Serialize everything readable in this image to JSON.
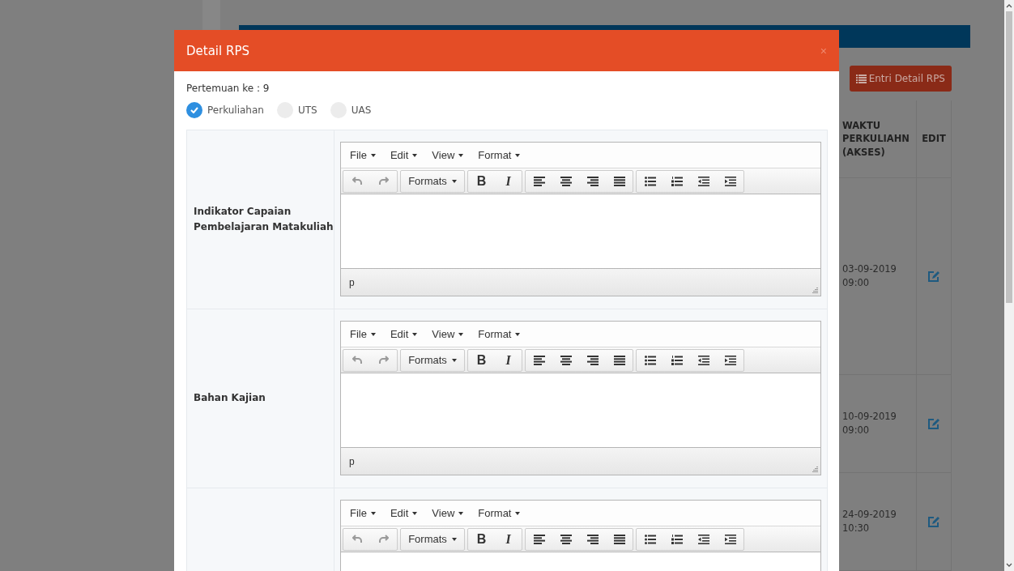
{
  "background_page": {
    "action_button": "Entri Detail RPS",
    "table": {
      "columns": [
        "WAKTU PERKULIAHN (AKSES)",
        "EDIT"
      ],
      "rows": [
        {
          "time": "03-09-2019 09:00"
        },
        {
          "time": "10-09-2019 09:00"
        },
        {
          "time": "24-09-2019 10:30"
        }
      ]
    }
  },
  "modal": {
    "title": "Detail RPS",
    "close": "×",
    "meeting_label": "Pertemuan ke : 9",
    "session_types": [
      {
        "label": "Perkuliahan",
        "selected": true
      },
      {
        "label": "UTS",
        "selected": false
      },
      {
        "label": "UAS",
        "selected": false
      }
    ],
    "fields": [
      {
        "label": "Indikator Capaian Pembelajaran Matakuliah",
        "editor": {
          "menu": [
            "File",
            "Edit",
            "View",
            "Format"
          ],
          "formats": "Formats",
          "bold": "B",
          "italic": "I",
          "undo_disabled": true,
          "redo_disabled": true,
          "path": "p"
        }
      },
      {
        "label": "Bahan Kajian",
        "editor": {
          "menu": [
            "File",
            "Edit",
            "View",
            "Format"
          ],
          "formats": "Formats",
          "bold": "B",
          "italic": "I",
          "undo_disabled": true,
          "redo_disabled": true,
          "path": "p"
        }
      },
      {
        "editor": {
          "menu": [
            "File",
            "Edit",
            "View",
            "Format"
          ],
          "formats": "Formats",
          "bold": "B",
          "italic": "I",
          "undo_disabled": true,
          "redo_disabled": true
        }
      }
    ]
  }
}
